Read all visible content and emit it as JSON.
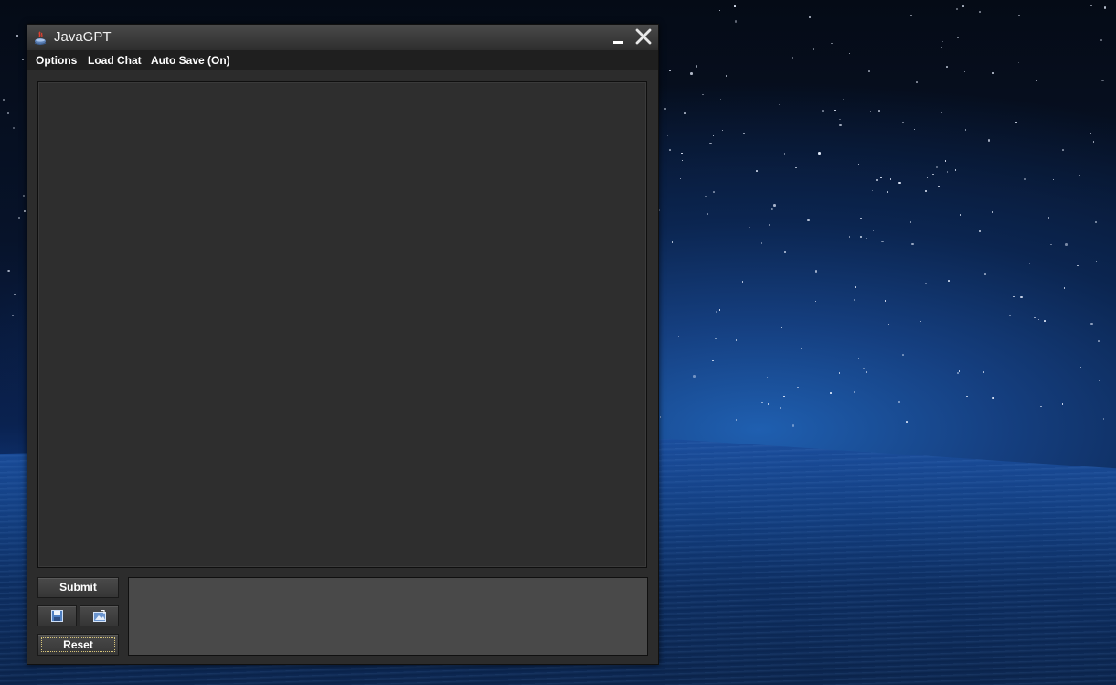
{
  "window": {
    "title": "JavaGPT"
  },
  "menu": {
    "items": [
      {
        "id": "options",
        "label": "Options"
      },
      {
        "id": "load-chat",
        "label": "Load Chat"
      },
      {
        "id": "auto-save",
        "label": "Auto Save (On)"
      }
    ]
  },
  "controls": {
    "submit_label": "Submit",
    "reset_label": "Reset",
    "save_icon": "floppy-disk-icon",
    "import_icon": "image-import-icon"
  },
  "chat": {
    "text": ""
  },
  "input": {
    "value": ""
  },
  "colors": {
    "window_bg": "#2c2c2c",
    "menubar_bg": "#1f1f1f",
    "input_bg": "#494949",
    "text": "#ffffff"
  }
}
